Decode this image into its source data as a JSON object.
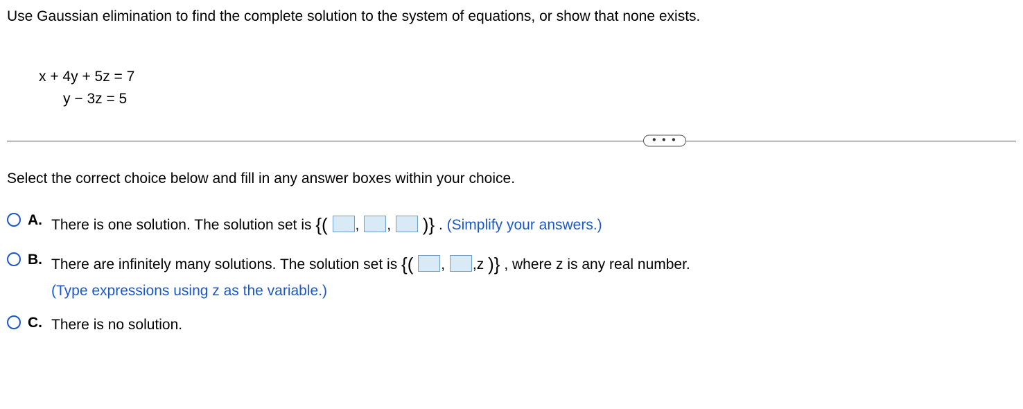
{
  "question": "Use Gaussian elimination to find the complete solution to the system of equations, or show that none exists.",
  "equations": {
    "line1": "x + 4y + 5z = 7",
    "line2": "      y − 3z = 5"
  },
  "divider_glyph": "• • •",
  "instruction": "Select the correct choice below and fill in any answer boxes within your choice.",
  "choices": {
    "a": {
      "letter": "A.",
      "text_before": "There is one solution. The solution set is ",
      "comma": ",",
      "text_after": ". ",
      "hint": "(Simplify your answers.)"
    },
    "b": {
      "letter": "B.",
      "text_before": "There are infinitely many solutions. The solution set is ",
      "z_suffix": ",z",
      "text_after": ", where z is any real number.",
      "hint": "(Type expressions using z as the variable.)"
    },
    "c": {
      "letter": "C.",
      "text": "There is no solution."
    }
  }
}
